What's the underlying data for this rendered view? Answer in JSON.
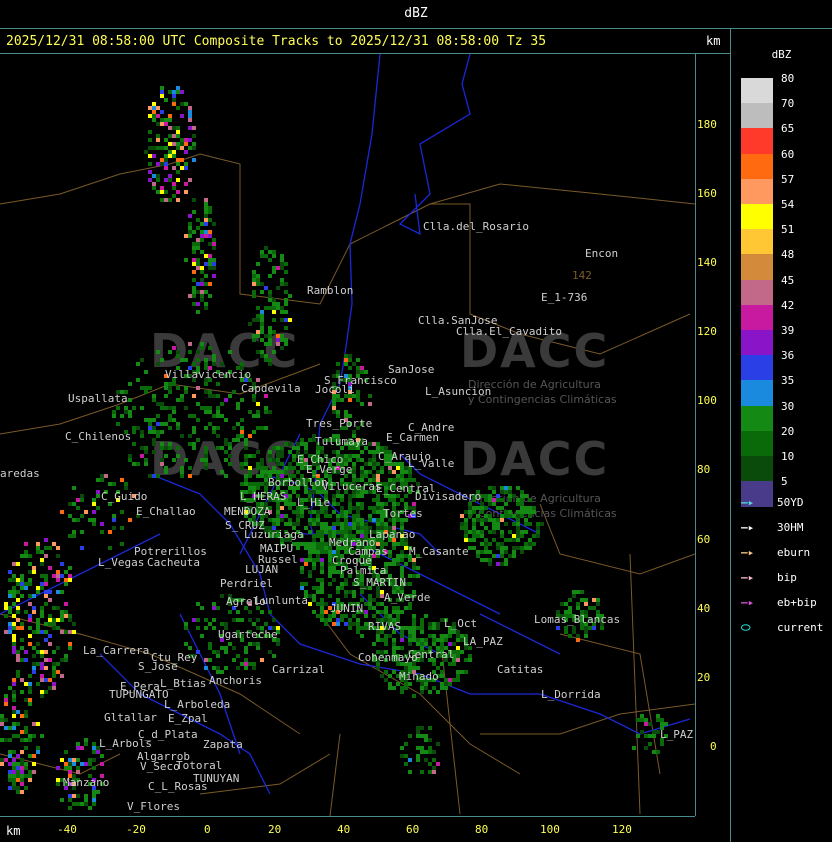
{
  "window_title": "dBZ",
  "header": "2025/12/31 08:58:00 UTC Composite Tracks to 2025/12/31 08:58:00 Tz 35",
  "km_unit": "km",
  "y_ticks": [
    "180",
    "160",
    "140",
    "120",
    "100",
    "80",
    "60",
    "40",
    "20",
    "0"
  ],
  "x_ticks": [
    "-40",
    "-20",
    "0",
    "20",
    "40",
    "60",
    "80",
    "100",
    "120"
  ],
  "legend": {
    "title": "dBZ",
    "levels": [
      {
        "label": "80",
        "color": "#d9d9d9"
      },
      {
        "label": "70",
        "color": "#bdbdbd"
      },
      {
        "label": "65",
        "color": "#ff3a2a"
      },
      {
        "label": "60",
        "color": "#ff6a10"
      },
      {
        "label": "57",
        "color": "#ff9960"
      },
      {
        "label": "54",
        "color": "#ffff00"
      },
      {
        "label": "51",
        "color": "#ffc733"
      },
      {
        "label": "48",
        "color": "#d38a3a"
      },
      {
        "label": "45",
        "color": "#c26888"
      },
      {
        "label": "42",
        "color": "#c71aa0"
      },
      {
        "label": "39",
        "color": "#8a14c8"
      },
      {
        "label": "36",
        "color": "#2a3fe6"
      },
      {
        "label": "35",
        "color": "#1a8adf"
      },
      {
        "label": "30",
        "color": "#148a14"
      },
      {
        "label": "20",
        "color": "#0a6a0a"
      },
      {
        "label": "10",
        "color": "#0a4a0a"
      },
      {
        "label": "5",
        "color": "#4a3a8a"
      }
    ],
    "tracks": [
      {
        "label": "50YD",
        "color": "#55dddd"
      },
      {
        "label": "30HM",
        "color": "#ffffff"
      },
      {
        "label": "eburn",
        "color": "#ffcc88"
      },
      {
        "label": "bip",
        "color": "#ffbbcc"
      },
      {
        "label": "eb+bip",
        "color": "#dd55dd"
      },
      {
        "label": "current",
        "color": "#22dddd"
      }
    ]
  },
  "watermark": {
    "brand": "DACC",
    "line1": "Dirección de Agricultura",
    "line2": "y Contingencias Climáticas"
  },
  "places": [
    "Clla.del_Rosario",
    "Encon",
    "142",
    "E_1-736",
    "Ramblon",
    "Clla.SanJose",
    "Clla.El_Cavadito",
    "Villavicencio",
    "S_Francisco",
    "SanJose",
    "Uspallata",
    "Capdevila",
    "Jocoli",
    "L_Asuncion",
    "Tres_Porte",
    "C_Andre",
    "C_Chilenos",
    "Tulumaya",
    "E_Carmen",
    "E_Chico",
    "C_Araujo",
    "L_Valle",
    "E_Verge",
    "Borbollon",
    "Viluceras",
    "E_Central",
    "Divisadero",
    "C_Guido",
    "L_HERAS",
    "E_Challao",
    "MENDOZA",
    "Tortes",
    "L_Hie",
    "S_CRUZ",
    "Lapanao",
    "Luzuriaga",
    "Medrano",
    "Potrerillos",
    "MAIPU",
    "Campas",
    "M_Casante",
    "L_Vegas",
    "Cacheuta",
    "Russel",
    "Croque",
    "Palmica",
    "LUJAN",
    "S_MARTIN",
    "Perdriel",
    "Lunlunta",
    "A_Verde",
    "Agrelo",
    "JUNIN",
    "Ugarteche",
    "RIVAS",
    "L_Oct",
    "Lomas_Blancas",
    "La_Carrera",
    "Ctu_Rey",
    "S_Jose",
    "Cohenmayo",
    "Central",
    "LA_PAZ",
    "Catitas",
    "Carrizal",
    "E_Pera",
    "L_Btias",
    "Anchoris",
    "Minado",
    "TUPUNGATO",
    "L_Arboleda",
    "L_Dorrida",
    "Gltallar",
    "E_Zpal",
    "C_d_Plata",
    "L_Arbols",
    "Zapata",
    "L_PAZ",
    "V_Seco",
    "Totoral",
    "Manzano",
    "TUNUYAN",
    "C_L_Rosas",
    "V_Flores",
    "Algarrob",
    "aredas"
  ]
}
